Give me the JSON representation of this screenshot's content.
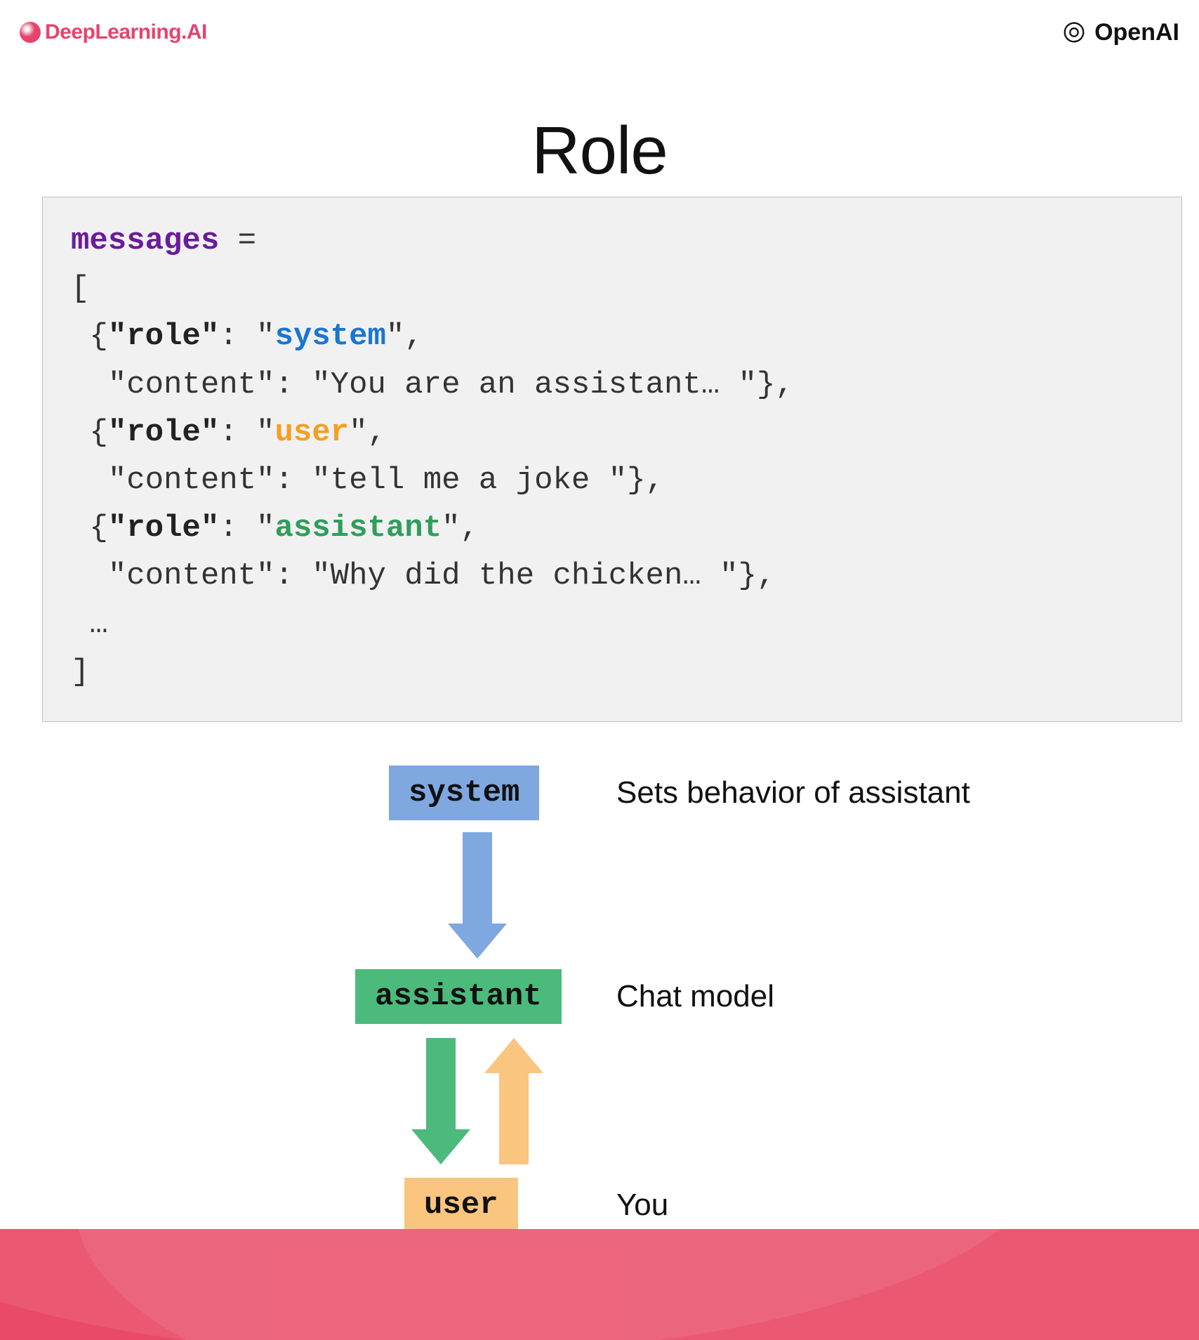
{
  "header": {
    "left_brand": "DeepLearning.AI",
    "right_brand": "OpenAI"
  },
  "title": "Role",
  "code": {
    "var": "messages",
    "eq": " =",
    "open_bracket": "[",
    "msg1_role_key": "\"role\"",
    "msg1_role_val": "system",
    "msg1_content_key": "\"content\"",
    "msg1_content_val": "\"You are an assistant… \"",
    "msg2_role_key": "\"role\"",
    "msg2_role_val": "user",
    "msg2_content_key": "\"content\"",
    "msg2_content_val": "\"tell me a joke \"",
    "msg3_role_key": "\"role\"",
    "msg3_role_val": "assistant",
    "msg3_content_key": "\"content\"",
    "msg3_content_val": "\"Why did the chicken… \"",
    "ellipsis": " …",
    "close_bracket": "]"
  },
  "diagram": {
    "system": {
      "label": "system",
      "description": "Sets behavior of assistant"
    },
    "assistant": {
      "label": "assistant",
      "description": "Chat model"
    },
    "user": {
      "label": "user",
      "description": "You"
    }
  },
  "colors": {
    "system": "#7fa8e0",
    "assistant": "#4cba7b",
    "user": "#f9c57f",
    "brand_pink": "#e6436d",
    "footer": "#e94a66"
  }
}
